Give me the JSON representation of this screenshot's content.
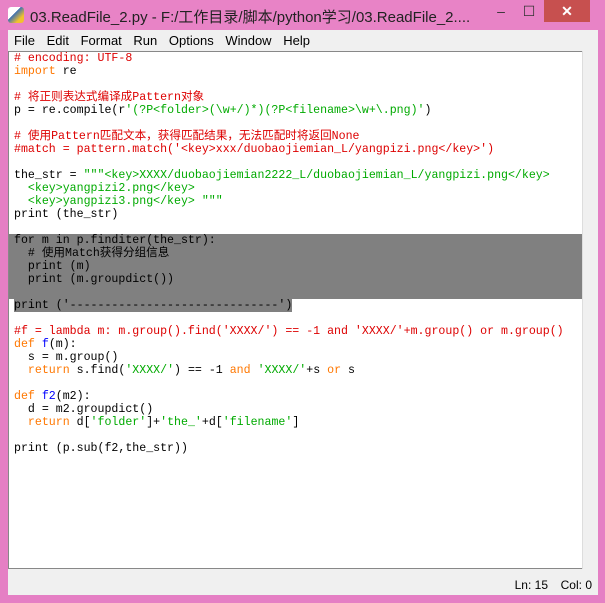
{
  "window": {
    "title": "03.ReadFile_2.py - F:/工作目录/脚本/python学习/03.ReadFile_2....",
    "minimize": "‒",
    "maximize": "☐",
    "close": "✕",
    "accent": "#e883c6"
  },
  "menu": [
    "File",
    "Edit",
    "Format",
    "Run",
    "Options",
    "Window",
    "Help"
  ],
  "status": {
    "line": "Ln: 15",
    "col": "Col: 0"
  },
  "selection": {
    "from_line": 15,
    "to_line": 20
  },
  "code": [
    [
      [
        "# encoding: UTF-8",
        "comment"
      ]
    ],
    [
      [
        "import",
        "keyword"
      ],
      [
        " re",
        "normal"
      ]
    ],
    [],
    [
      [
        "# 将正则表达式编译成Pattern对象",
        "comment"
      ]
    ],
    [
      [
        "p = re.compile(r",
        "normal"
      ],
      [
        "'(?P<folder>(\\w+/)*)(?P<filename>\\w+\\.png)'",
        "string"
      ],
      [
        ")",
        "normal"
      ]
    ],
    [],
    [
      [
        "# 使用Pattern匹配文本，获得匹配结果，无法匹配时将返回None",
        "comment"
      ]
    ],
    [
      [
        "#match = pattern.match('<key>xxx/duobaojiemian_L/yangpizi.png</key>')",
        "comment"
      ]
    ],
    [],
    [
      [
        "the_str = ",
        "normal"
      ],
      [
        "\"\"\"<key>XXXX/duobaojiemian2222_L/duobaojiemian_L/yangpizi.png</key>",
        "string"
      ]
    ],
    [
      [
        "  <key>yangpizi2.png</key>",
        "string"
      ]
    ],
    [
      [
        "  <key>yangpizi3.png</key> \"\"\"",
        "string"
      ]
    ],
    [
      [
        "print (the_str)",
        "normal"
      ]
    ],
    [],
    [
      [
        "for m in p.finditer(the_str):",
        "normal"
      ]
    ],
    [
      [
        "  # 使用Match获得分组信息",
        "comment"
      ]
    ],
    [
      [
        "  print (m)",
        "normal"
      ]
    ],
    [
      [
        "  print (m.groupdict())",
        "normal"
      ]
    ],
    [],
    [
      [
        "print ('------------------------------')",
        "normal"
      ]
    ],
    [],
    [
      [
        "#f = lambda m: m.group().find('XXXX/') == -1 and 'XXXX/'+m.group() or m.group()",
        "comment"
      ]
    ],
    [
      [
        "def",
        "keyword"
      ],
      [
        " ",
        "normal"
      ],
      [
        "f",
        "defname"
      ],
      [
        "(m):",
        "normal"
      ]
    ],
    [
      [
        "  s = m.group()",
        "normal"
      ]
    ],
    [
      [
        "  ",
        "normal"
      ],
      [
        "return",
        "keyword"
      ],
      [
        " s.find(",
        "normal"
      ],
      [
        "'XXXX/'",
        "string"
      ],
      [
        ") == -1 ",
        "normal"
      ],
      [
        "and",
        "keyword"
      ],
      [
        " ",
        "normal"
      ],
      [
        "'XXXX/'",
        "string"
      ],
      [
        "+s ",
        "normal"
      ],
      [
        "or",
        "keyword"
      ],
      [
        " s",
        "normal"
      ]
    ],
    [],
    [
      [
        "def",
        "keyword"
      ],
      [
        " ",
        "normal"
      ],
      [
        "f2",
        "defname"
      ],
      [
        "(m2):",
        "normal"
      ]
    ],
    [
      [
        "  d = m2.groupdict()",
        "normal"
      ]
    ],
    [
      [
        "  ",
        "normal"
      ],
      [
        "return",
        "keyword"
      ],
      [
        " d[",
        "normal"
      ],
      [
        "'folder'",
        "string"
      ],
      [
        "]+",
        "normal"
      ],
      [
        "'the_'",
        "string"
      ],
      [
        "+d[",
        "normal"
      ],
      [
        "'filename'",
        "string"
      ],
      [
        "]",
        "normal"
      ]
    ],
    [],
    [
      [
        "print (p.sub(f2,the_str))",
        "normal"
      ]
    ]
  ]
}
